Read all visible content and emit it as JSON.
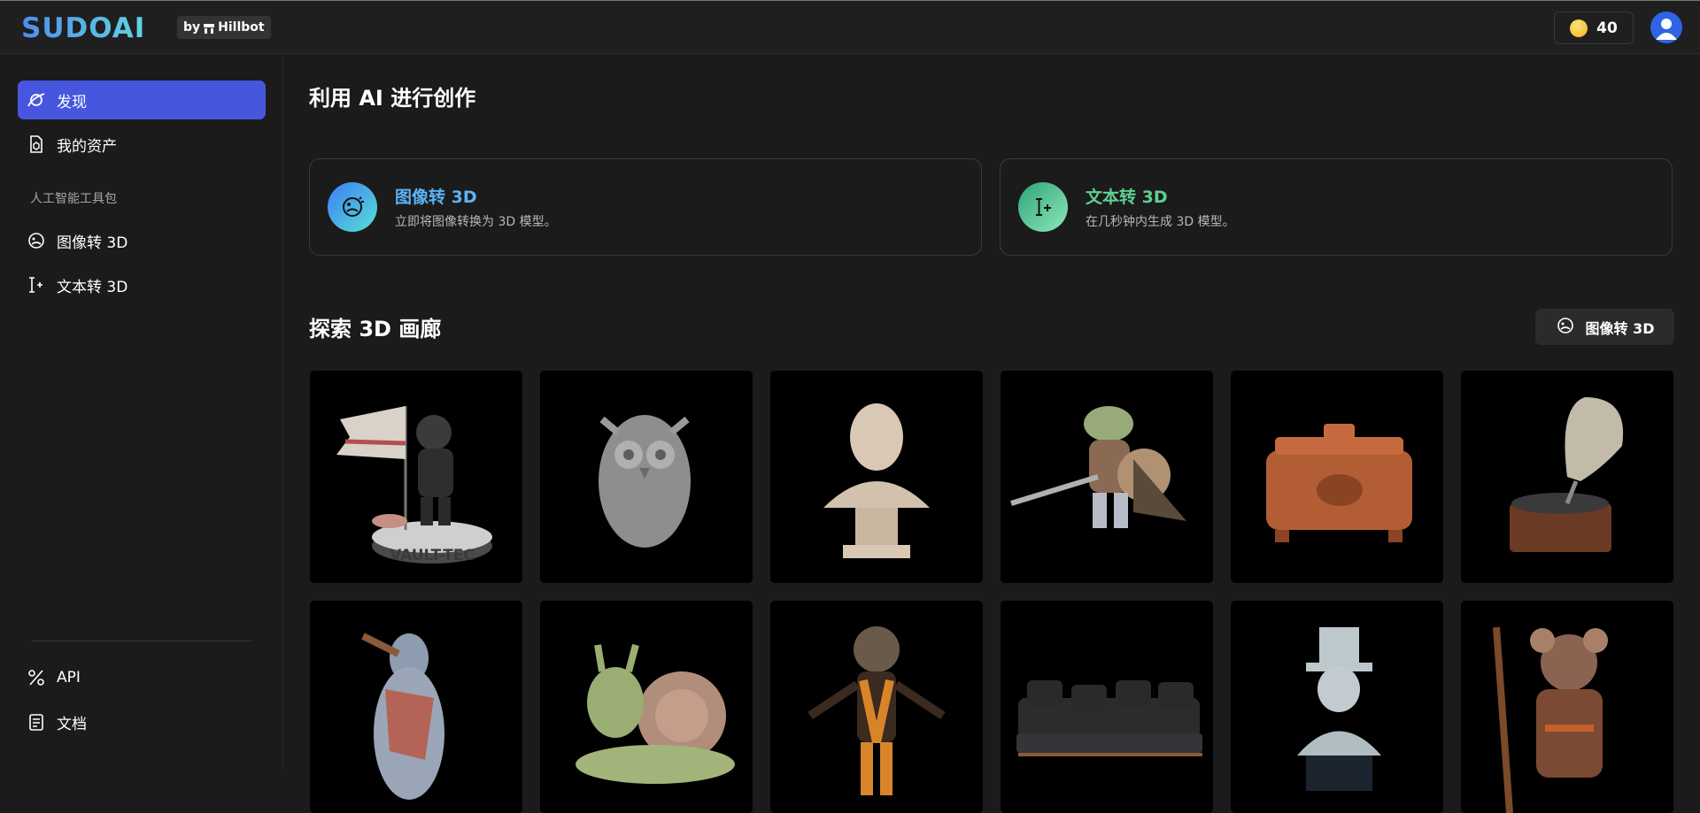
{
  "header": {
    "logo": "SUDOAI",
    "by_label": "by",
    "brand": "Hillbot",
    "credits": "40"
  },
  "sidebar": {
    "nav": [
      {
        "label": "发现",
        "icon": "planet-icon",
        "active": true
      },
      {
        "label": "我的资产",
        "icon": "asset-file-icon",
        "active": false
      }
    ],
    "toolkit_label": "人工智能工具包",
    "tools": [
      {
        "label": "图像转 3D",
        "icon": "image-to-3d-icon"
      },
      {
        "label": "文本转 3D",
        "icon": "text-to-3d-icon"
      }
    ],
    "footer": [
      {
        "label": "API",
        "icon": "api-icon"
      },
      {
        "label": "文档",
        "icon": "docs-icon"
      }
    ]
  },
  "main": {
    "title": "利用 AI 进行创作",
    "features": [
      {
        "title": "图像转 3D",
        "desc": "立即将图像转换为 3D 模型。",
        "icon": "image-to-3d-icon",
        "color": "#5ab4f5"
      },
      {
        "title": "文本转 3D",
        "desc": "在几秒钟内生成 3D 模型。",
        "icon": "text-to-3d-icon",
        "color": "#5fd08f"
      }
    ],
    "gallery_title": "探索 3D 画廊",
    "gallery_button": "图像转 3D",
    "gallery": {
      "vault_text": "VAULT-TEC",
      "items": [
        "vault-boy-flag-model",
        "owl-model",
        "bust-model",
        "frog-knight-model",
        "carved-chest-model",
        "gramophone-model",
        "pigeon-model",
        "snail-model",
        "raccoon-model",
        "sofa-model",
        "top-hat-bust-model",
        "mouse-adventurer-model"
      ]
    }
  },
  "colors": {
    "accent": "#4656de",
    "background": "#1b1b1b",
    "feature_image": "#5ab4f5",
    "feature_text": "#5fd08f"
  }
}
